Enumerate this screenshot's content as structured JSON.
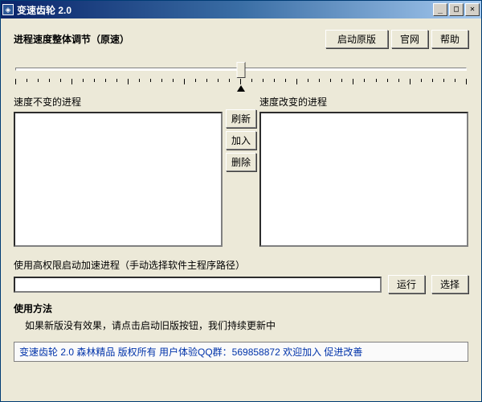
{
  "window": {
    "title": "变速齿轮 2.0"
  },
  "header": {
    "section_label": "进程速度整体调节（原速）",
    "launch_original": "启动原版",
    "official_site": "官网",
    "help": "帮助"
  },
  "lists": {
    "left_label": "速度不变的进程",
    "right_label": "速度改变的进程",
    "refresh": "刷新",
    "add": "加入",
    "remove": "删除"
  },
  "path": {
    "label": "使用高权限启动加速进程（手动选择软件主程序路径）",
    "value": "",
    "run": "运行",
    "browse": "选择"
  },
  "usage": {
    "title": "使用方法",
    "body": "如果新版没有效果，请点击启动旧版按钮，我们持续更新中"
  },
  "footer": {
    "text": "变速齿轮 2.0 森林精品 版权所有 用户体验QQ群：569858872 欢迎加入 促进改善"
  }
}
